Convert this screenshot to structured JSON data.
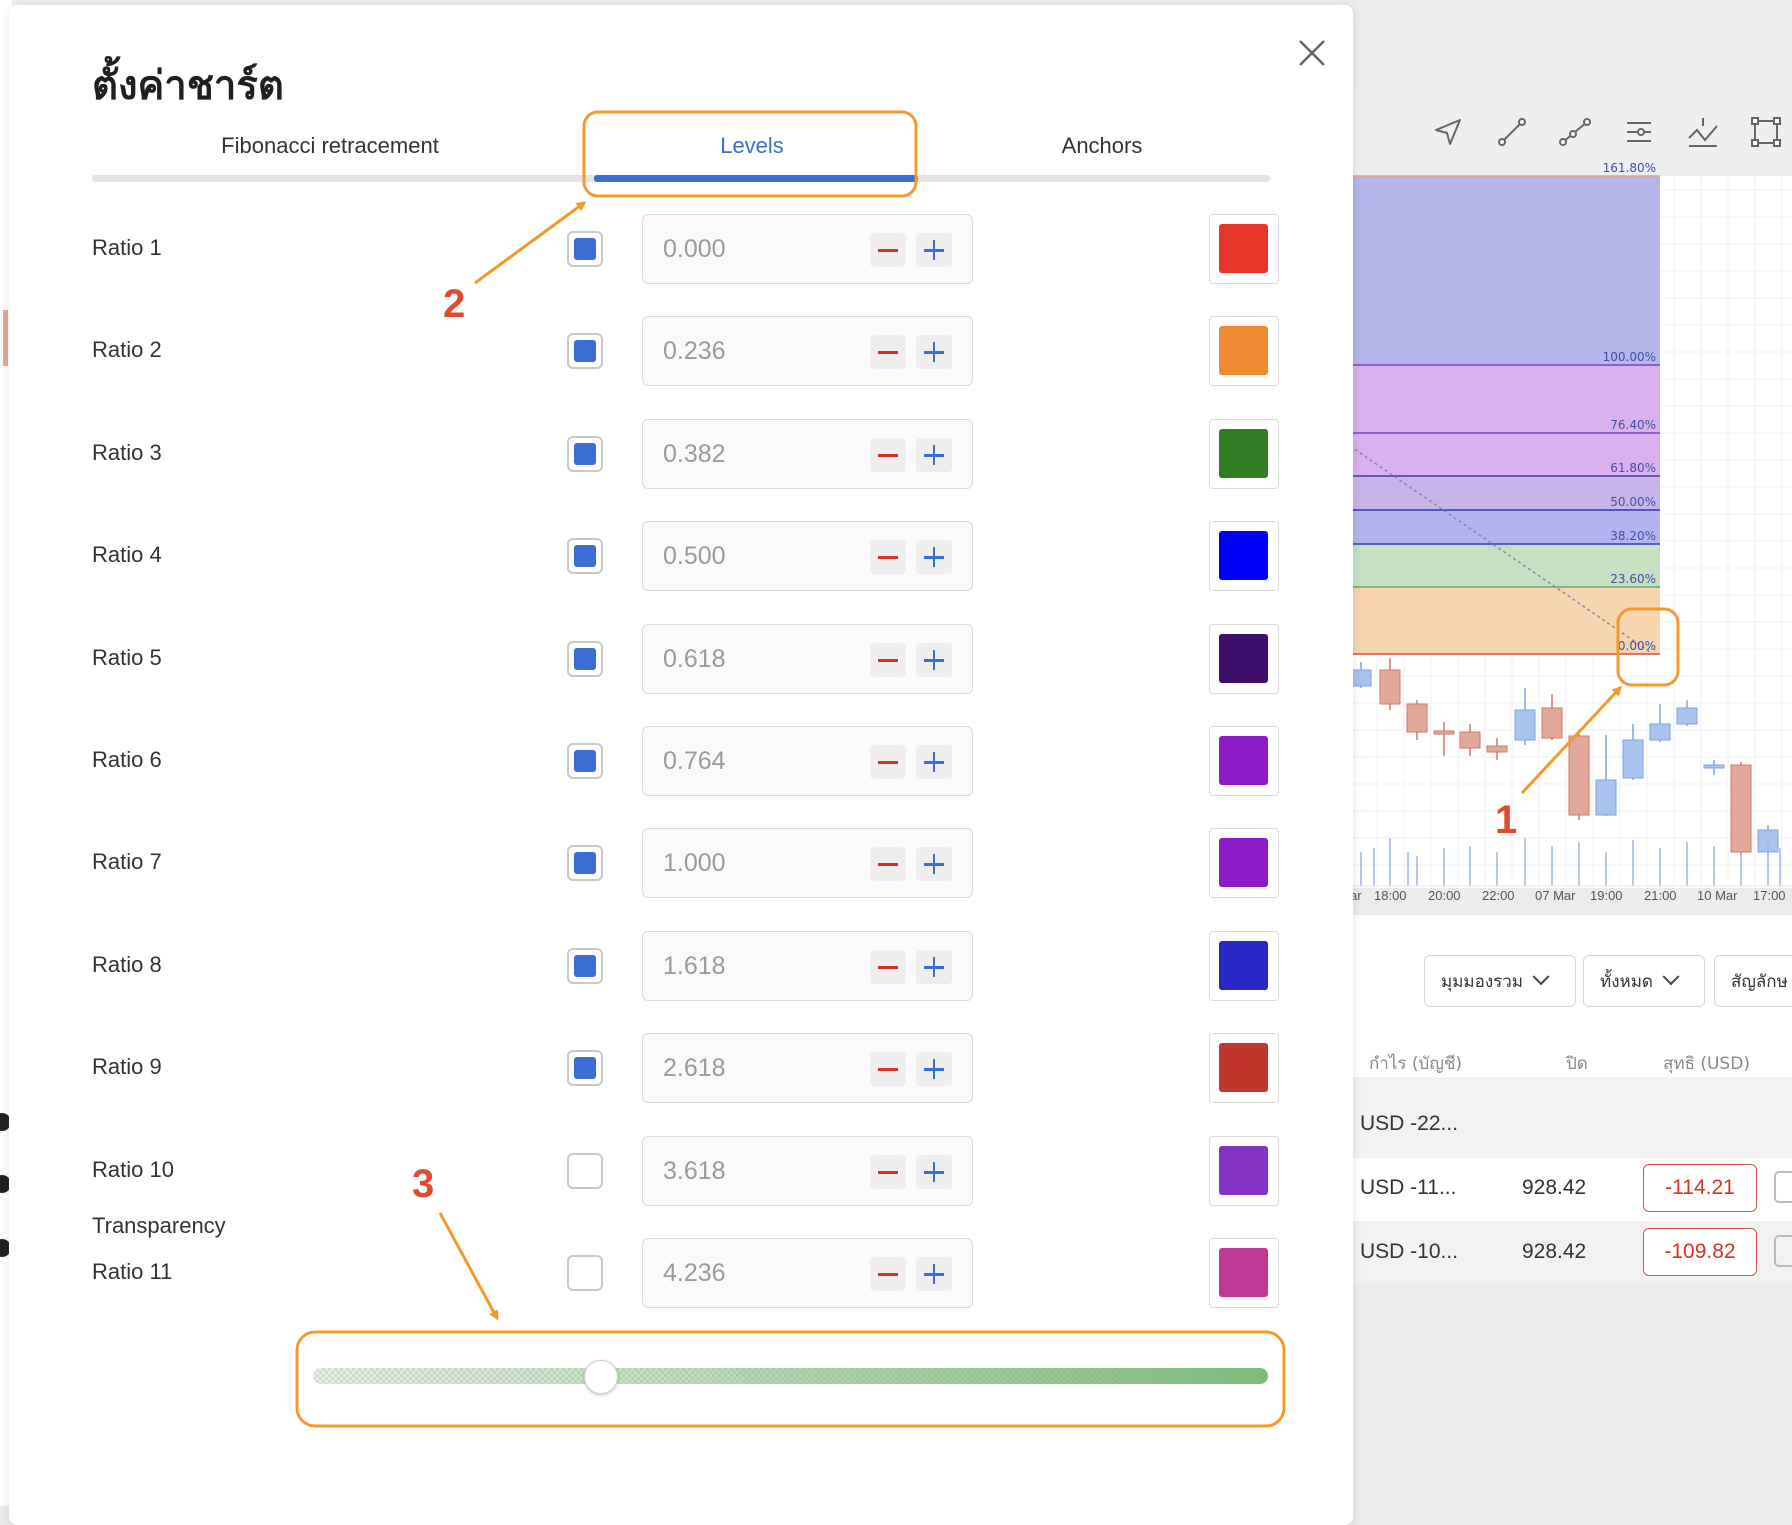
{
  "dialog": {
    "title": "ตั้งค่าชาร์ต",
    "tabs": [
      {
        "label": "Fibonacci retracement",
        "active": false
      },
      {
        "label": "Levels",
        "active": true
      },
      {
        "label": "Anchors",
        "active": false
      }
    ],
    "ratios": [
      {
        "label": "Ratio 1",
        "checked": true,
        "value": "0.000",
        "color": "#e8352a"
      },
      {
        "label": "Ratio 2",
        "checked": true,
        "value": "0.236",
        "color": "#f08a32"
      },
      {
        "label": "Ratio 3",
        "checked": true,
        "value": "0.382",
        "color": "#317d23"
      },
      {
        "label": "Ratio 4",
        "checked": true,
        "value": "0.500",
        "color": "#0000ff"
      },
      {
        "label": "Ratio 5",
        "checked": true,
        "value": "0.618",
        "color": "#3d0e6e"
      },
      {
        "label": "Ratio 6",
        "checked": true,
        "value": "0.764",
        "color": "#8a1bc7"
      },
      {
        "label": "Ratio 7",
        "checked": true,
        "value": "1.000",
        "color": "#8a1bc7"
      },
      {
        "label": "Ratio 8",
        "checked": true,
        "value": "1.618",
        "color": "#2828c4"
      },
      {
        "label": "Ratio 9",
        "checked": true,
        "value": "2.618",
        "color": "#c0352c"
      },
      {
        "label": "Ratio 10",
        "checked": false,
        "value": "3.618",
        "color": "#8433c5"
      },
      {
        "label": "Ratio 11",
        "checked": false,
        "value": "4.236",
        "color": "#c13894"
      }
    ],
    "transparency": {
      "label": "Transparency",
      "fraction": 0.3
    }
  },
  "chart": {
    "fib_labels": [
      "161.80%",
      "100.00%",
      "76.40%",
      "61.80%",
      "50.00%",
      "38.20%",
      "23.60%",
      "0.00%"
    ],
    "time_axis": [
      "ar",
      "18:00",
      "20:00",
      "22:00",
      "07 Mar",
      "19:00",
      "21:00",
      "10 Mar",
      "17:00"
    ]
  },
  "positions_panel": {
    "filters": [
      "มุมมองรวม",
      "ทั้งหมด",
      "สัญลักษ"
    ],
    "headers": [
      "กำไร (บัญชี)",
      "ปิด",
      "สุทธิ (USD)"
    ],
    "rows": [
      {
        "profit": "USD -22...",
        "close": "",
        "net": ""
      },
      {
        "profit": "USD -11...",
        "close": "928.42",
        "net": "-114.21"
      },
      {
        "profit": "USD -10...",
        "close": "928.42",
        "net": "-109.82"
      }
    ]
  },
  "annotations": [
    "1",
    "2",
    "3"
  ],
  "icons": [
    "close-icon",
    "arrow-tool-icon",
    "trend-line-icon",
    "polyline-icon",
    "fib-levels-icon",
    "path-tool-icon",
    "rectangle-tool-icon",
    "chevron-down-icon"
  ],
  "colors": {
    "accent": "#3b6ed3",
    "annotation": "#f39a2c",
    "annotation_number": "#e04b2e",
    "negative": "#d93025"
  }
}
